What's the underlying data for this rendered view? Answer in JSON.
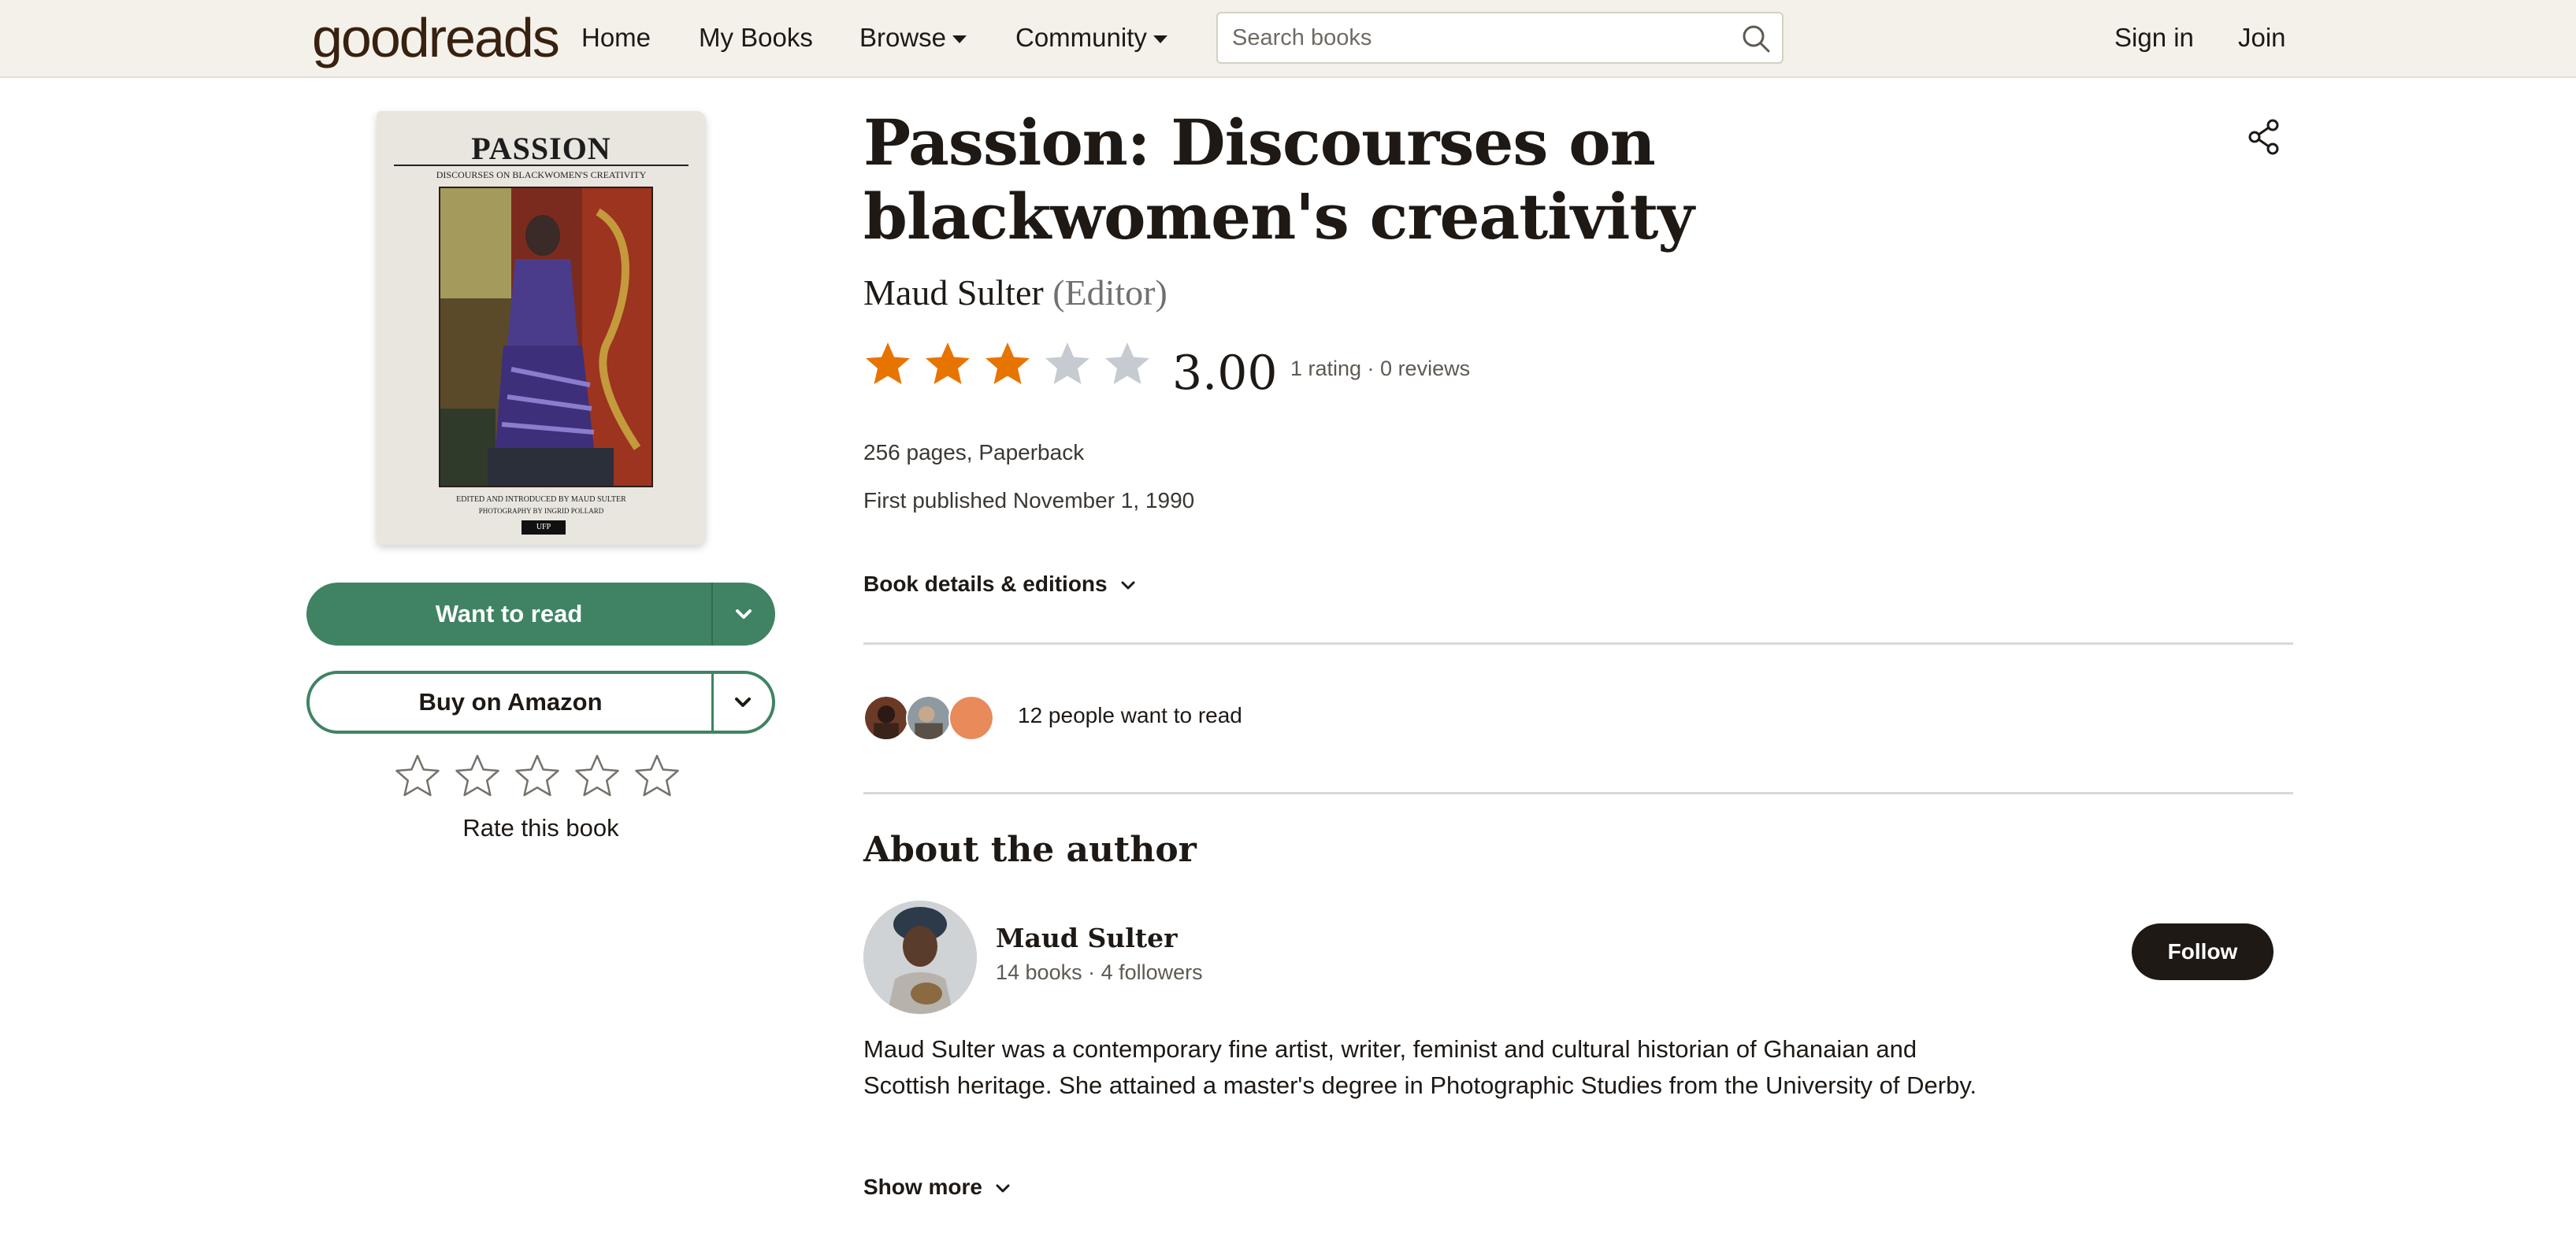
{
  "header": {
    "logo": {
      "part1": "good",
      "part2": "reads"
    },
    "nav": {
      "home": "Home",
      "my_books": "My Books",
      "browse": "Browse",
      "community": "Community"
    },
    "search_placeholder": "Search books",
    "sign_in": "Sign in",
    "join": "Join"
  },
  "cover": {
    "title": "PASSION",
    "subtitle": "DISCOURSES ON BLACKWOMEN'S CREATIVITY",
    "edited_line": "EDITED AND INTRODUCED BY MAUD SULTER",
    "photo_line": "PHOTOGRAPHY BY INGRID POLLARD",
    "publisher_mark": "UFP"
  },
  "actions": {
    "want_to_read": "Want to read",
    "buy": "Buy on Amazon",
    "rate_label": "Rate this book",
    "rate_star_count": 5
  },
  "book": {
    "title": "Passion: Discourses on blackwomen's creativity",
    "author": "Maud Sulter",
    "author_role": "(Editor)",
    "rating_value": 3,
    "rating_display": "3.00",
    "ratings_counts": "1 rating · 0 reviews",
    "format": "256 pages, Paperback",
    "first_published": "First published November 1, 1990",
    "details_link": "Book details & editions",
    "want_to_read_people": "12 people want to read"
  },
  "about": {
    "heading": "About the author",
    "name": "Maud Sulter",
    "stats": "14 books · 4 followers",
    "follow": "Follow",
    "bio": "Maud Sulter was a contemporary fine artist, writer, feminist and cultural historian of Ghanaian and Scottish heritage. She attained a master's degree in Photographic Studies from the University of Derby.",
    "show_more": "Show more"
  },
  "colors": {
    "header_bg": "#f4f1ea",
    "green": "#3f8363",
    "star_filled": "#e87400",
    "star_empty": "#c6cbd1",
    "dark": "#1e1915"
  },
  "icons": {
    "search": "search-icon",
    "share": "share-icon",
    "chevron": "chevron-down-icon",
    "star": "star-icon"
  }
}
